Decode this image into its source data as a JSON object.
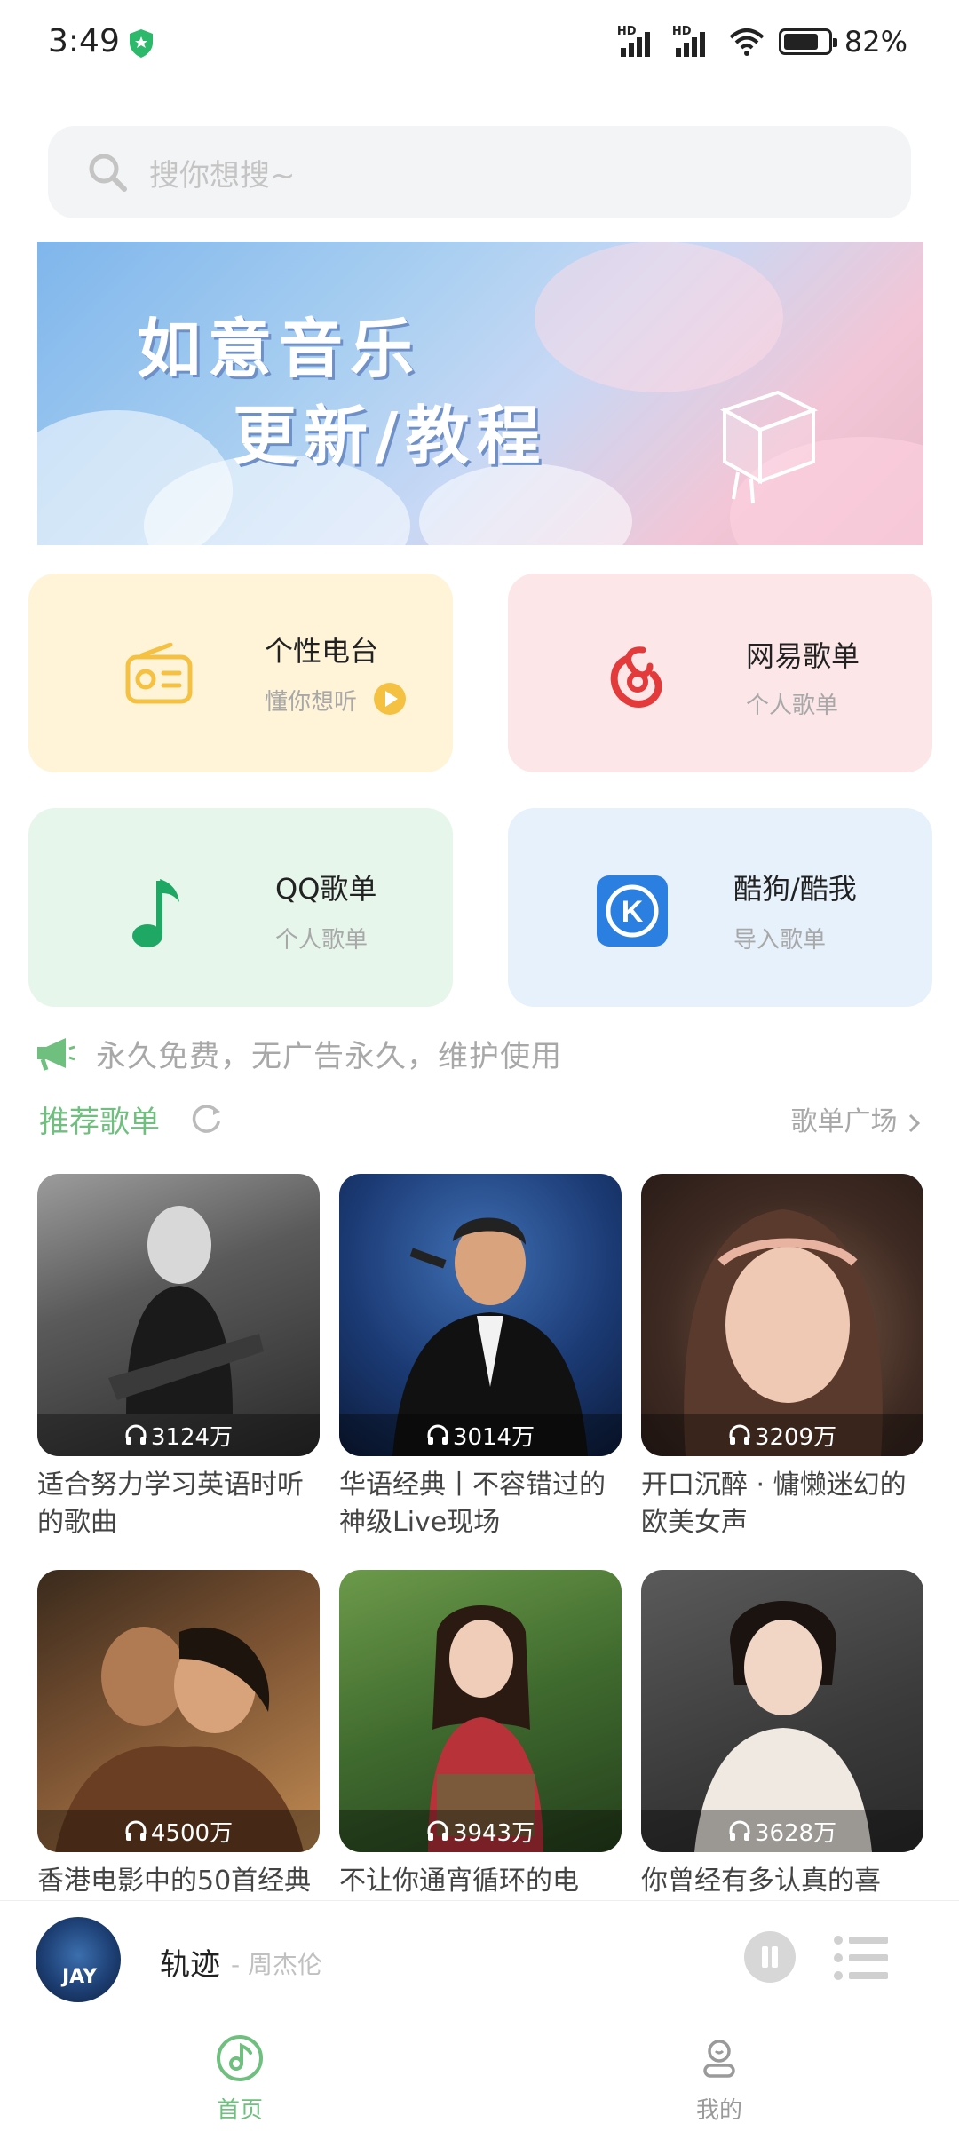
{
  "status_bar": {
    "time": "3:49",
    "battery": "82%",
    "battery_level": 0.82
  },
  "search": {
    "placeholder": "搜你想搜~"
  },
  "banner": {
    "line1": "如意音乐",
    "line2": "更新/教程"
  },
  "cards": [
    {
      "title": "个性电台",
      "subtitle": "懂你想听",
      "icon": "radio-icon"
    },
    {
      "title": "网易歌单",
      "subtitle": "个人歌单",
      "icon": "netease-music-icon"
    },
    {
      "title": "QQ歌单",
      "subtitle": "个人歌单",
      "icon": "qq-music-note-icon"
    },
    {
      "title": "酷狗/酷我",
      "subtitle": "导入歌单",
      "icon": "kugou-icon"
    }
  ],
  "notice": {
    "text": "永久免费，无广告永久，维护使用",
    "icon": "megaphone-icon"
  },
  "section": {
    "title": "推荐歌单",
    "more": "歌单广场"
  },
  "playlists": [
    {
      "count": "3124万",
      "name": "适合努力学习英语时听的歌曲"
    },
    {
      "count": "3014万",
      "name": "华语经典丨不容错过的神级Live现场"
    },
    {
      "count": "3209万",
      "name": "开口沉醉 · 慵懒迷幻的欧美女声"
    },
    {
      "count": "4500万",
      "name": "香港电影中的50首经典"
    },
    {
      "count": "3943万",
      "name": "不让你通宵循环的电"
    },
    {
      "count": "3628万",
      "name": "你曾经有多认真的喜"
    }
  ],
  "player": {
    "song": "轨迹",
    "artist": "- 周杰伦",
    "cover_text": "JAY"
  },
  "tabs": {
    "home": "首页",
    "mine": "我的"
  },
  "colors": {
    "accent": "#6fbf7f",
    "netease": "#e33b3b",
    "qq": "#1fa864",
    "kugou": "#2b7fe0",
    "radio": "#f5c142"
  }
}
